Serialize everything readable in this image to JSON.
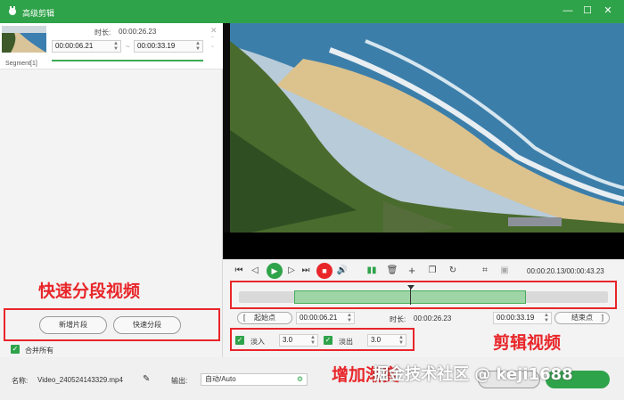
{
  "window": {
    "title": "高级剪辑",
    "controls": {
      "minimize": "—",
      "maximize": "☐",
      "close": "✕"
    }
  },
  "segment": {
    "label": "Segment[1]",
    "duration_label": "时长:",
    "duration": "00:00:26.23",
    "start": "00:00:06.21",
    "end": "00:00:33.19",
    "separator": "~",
    "close": "✕"
  },
  "left_actions": {
    "new_segment": "新增片段",
    "quick_split": "快速分段",
    "merge_all": "合并所有"
  },
  "overlays": {
    "quick_split_video": "快速分段视频",
    "edit_video": "剪辑视频",
    "add_fade": "增加渐变",
    "watermark": "掘金技术社区 @ keji1688"
  },
  "player": {
    "timecode": "00:00:20.13/00:00:43.23"
  },
  "trim": {
    "start_point_btn": "起始点",
    "start_time": "00:00:06.21",
    "duration_label": "时长:",
    "duration": "00:00:26.23",
    "end_time": "00:00:33.19",
    "end_point_btn": "结束点"
  },
  "fade": {
    "fade_in_label": "淡入",
    "fade_in_value": "3.0",
    "fade_out_label": "淡出",
    "fade_out_value": "3.0"
  },
  "output": {
    "name_label": "名称:",
    "filename": "Video_240524143329.mp4",
    "output_label": "输出:",
    "format": "自动/Auto"
  },
  "colors": {
    "brand_green": "#2fa34a",
    "stop_red": "#e8262a",
    "timeline_selection": "#9fd5a6"
  }
}
